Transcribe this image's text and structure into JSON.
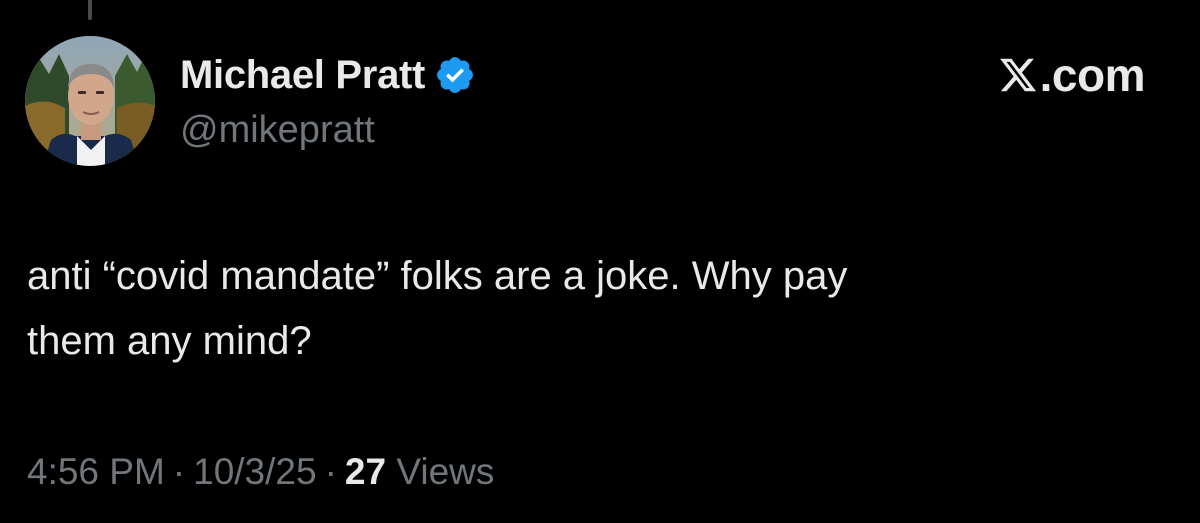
{
  "author": {
    "display_name": "Michael Pratt",
    "handle": "@mikepratt",
    "verified": true,
    "verified_badge_color": "#1d9bf0"
  },
  "brand": {
    "icon": "x-logo-icon",
    "suffix": ".com"
  },
  "tweet": {
    "text_line_1": "anti “covid mandate” folks are a joke. Why pay",
    "text_line_2": "them any mind?",
    "time": "4:56 PM",
    "separator": "·",
    "date": "10/3/25",
    "views_count": "27",
    "views_label": "Views"
  },
  "colors": {
    "background": "#000000",
    "primary_text": "#e7e9ea",
    "secondary_text": "#71767b"
  }
}
